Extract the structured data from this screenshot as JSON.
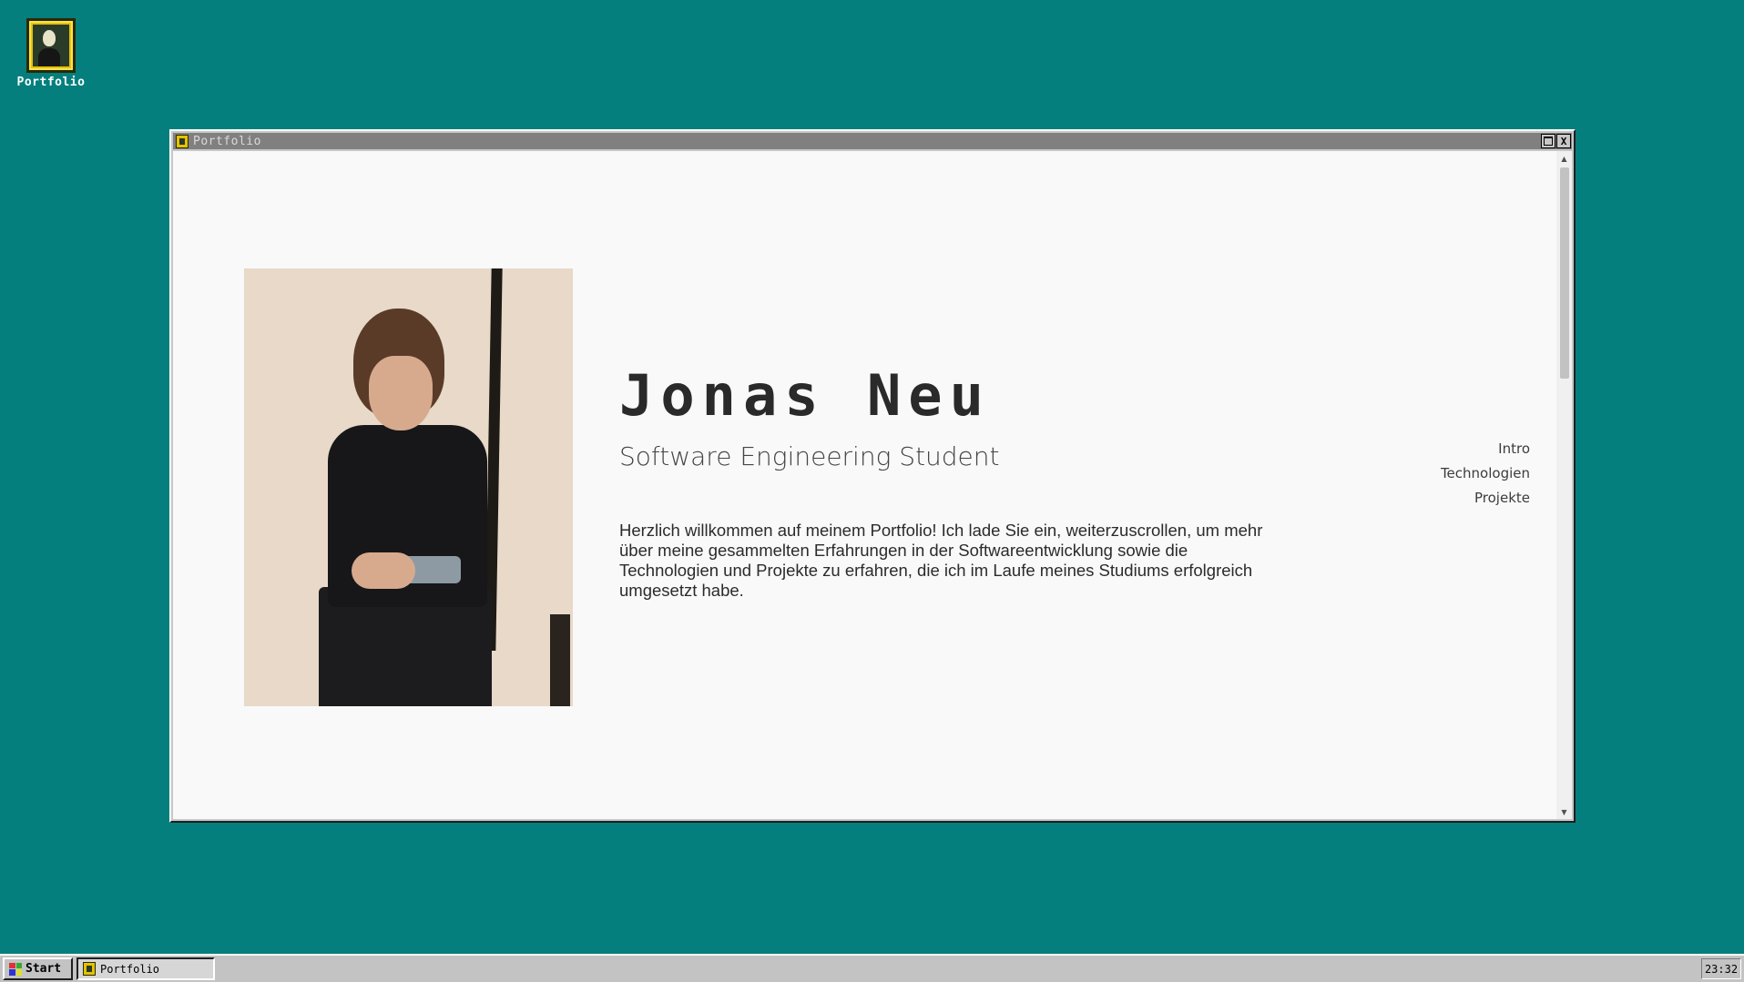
{
  "desktop": {
    "icons": [
      {
        "label": "Portfolio",
        "icon": "framed-portrait-icon"
      }
    ]
  },
  "window": {
    "title": "Portfolio",
    "controls": {
      "maximize_icon": "maximize-icon",
      "close_label": "X"
    }
  },
  "page": {
    "name": "Jonas Neu",
    "subtitle": "Software Engineering Student",
    "intro": "Herzlich willkommen auf meinem Portfolio! Ich lade Sie ein, weiterzuscrollen, um mehr über meine gesammelten Erfahrungen in der Softwareentwicklung sowie die Technologien und Projekte zu erfahren, die ich im Laufe meines Studiums erfolgreich umgesetzt habe.",
    "nav": [
      "Intro",
      "Technologien",
      "Projekte"
    ]
  },
  "taskbar": {
    "start_label": "Start",
    "tasks": [
      {
        "label": "Portfolio"
      }
    ],
    "clock": "23:32"
  },
  "colors": {
    "desktop": "#047f7d",
    "titlebar": "#808080",
    "content_bg": "#f9f9f9",
    "taskbar": "#c3c3c3"
  }
}
